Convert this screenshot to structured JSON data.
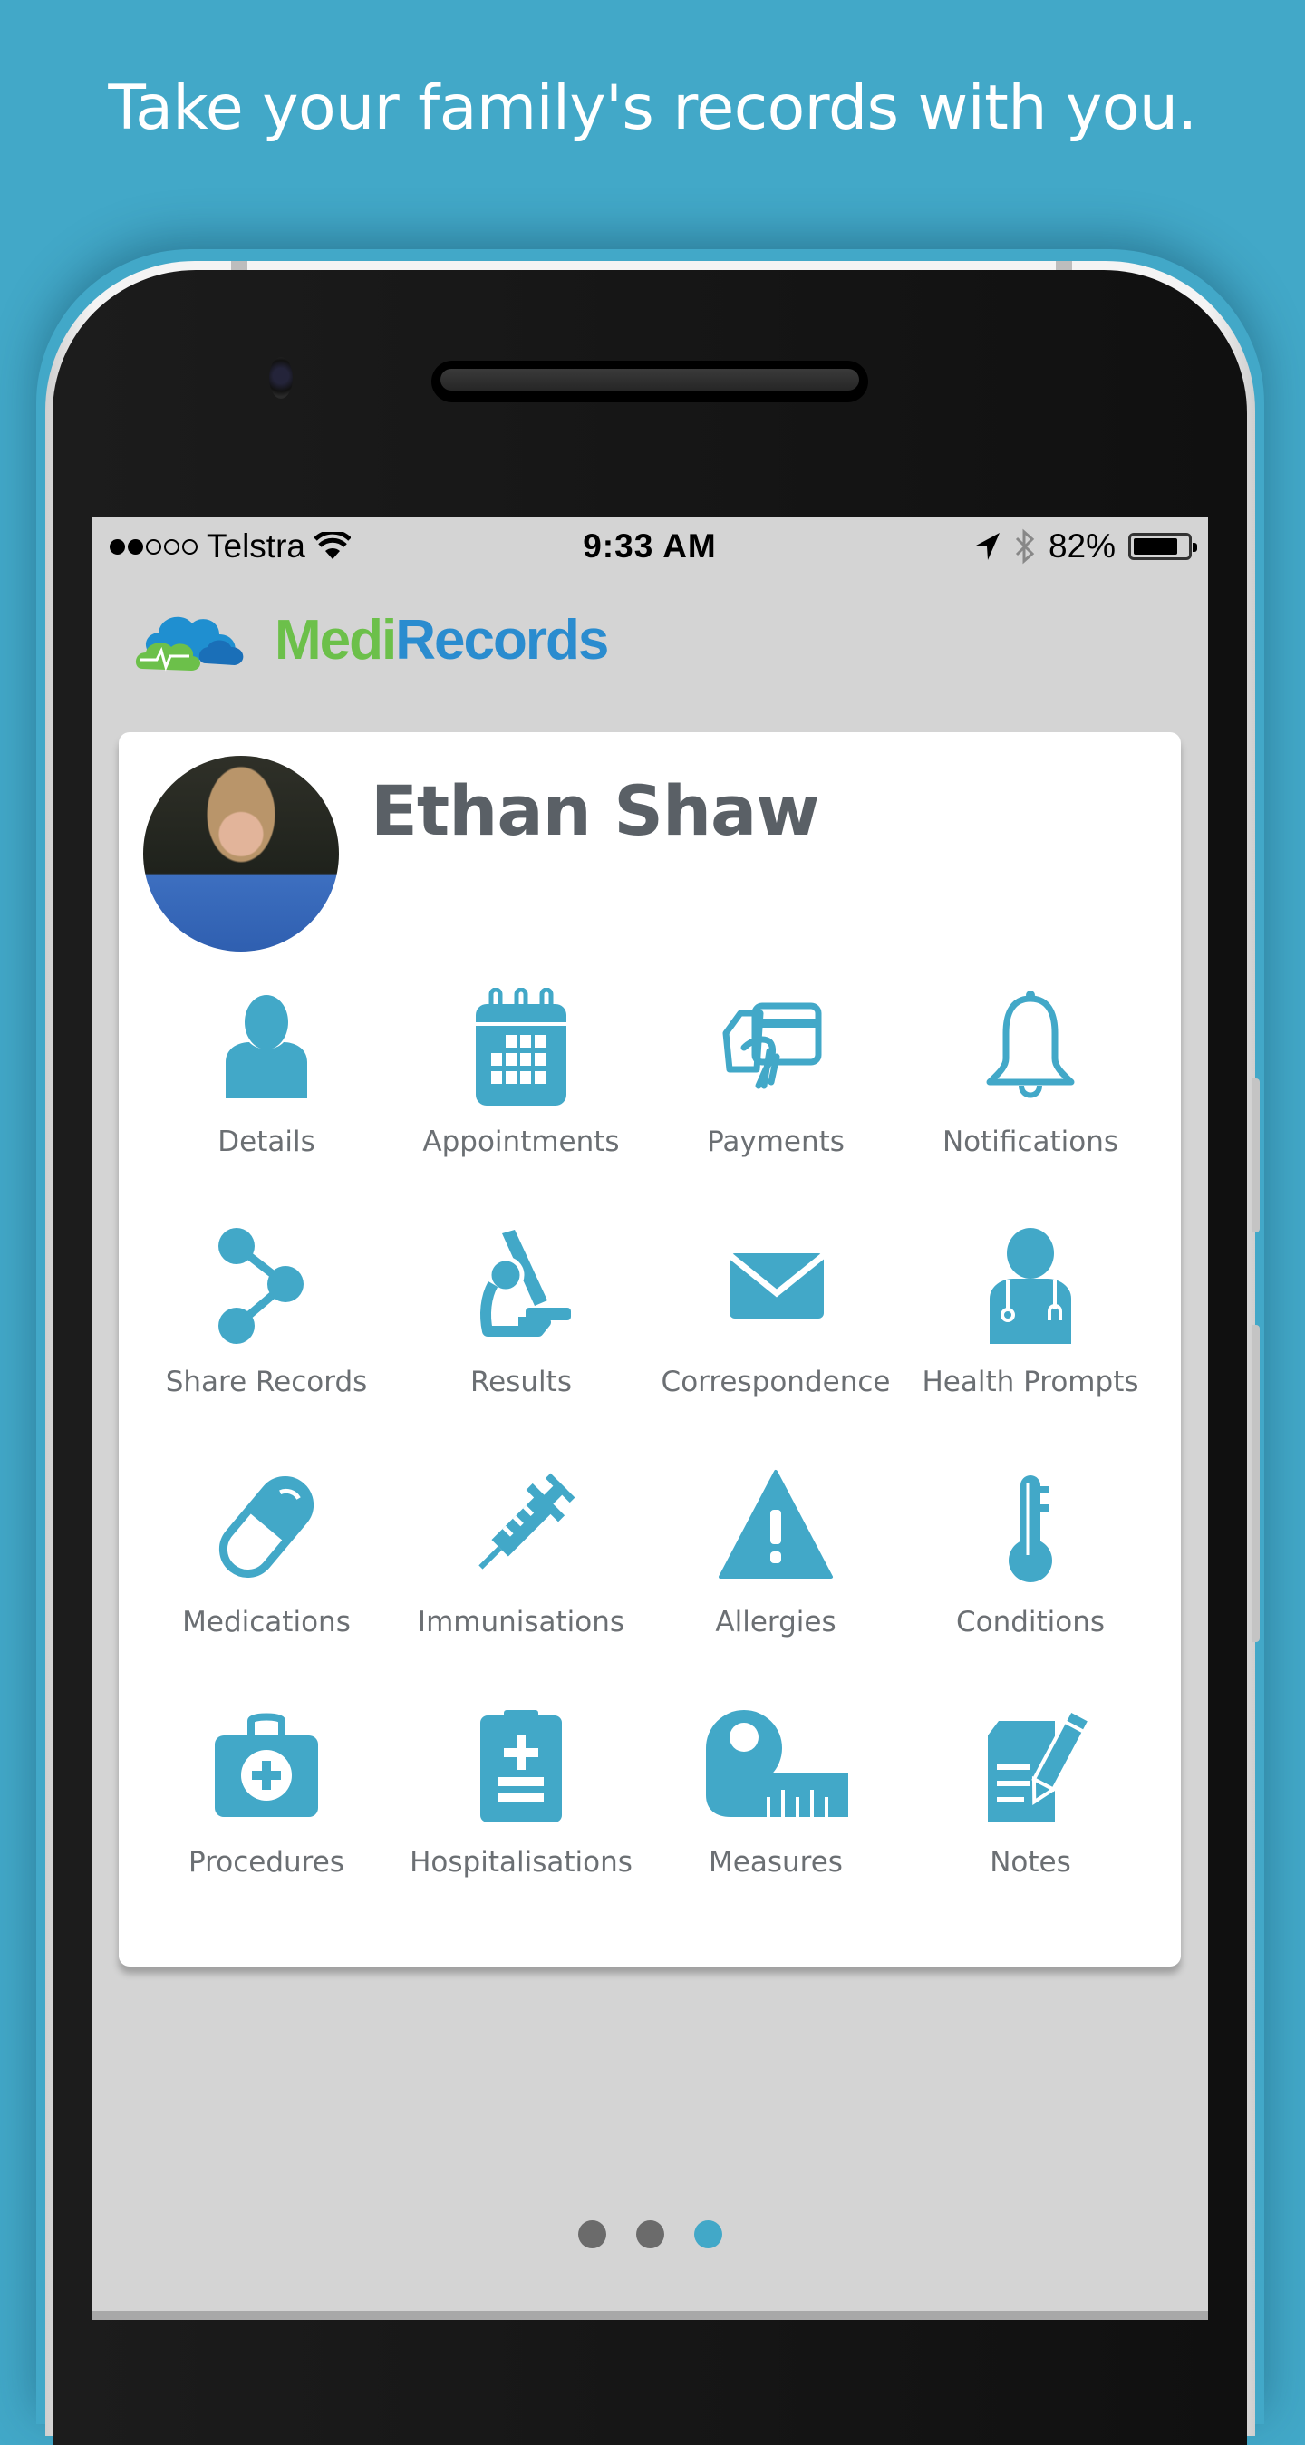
{
  "headline": "Take your family's records with you.",
  "status_bar": {
    "signal_bars_filled": 2,
    "signal_bars_total": 5,
    "carrier": "Telstra",
    "wifi_icon": "wifi-icon",
    "time": "9:33 AM",
    "location_icon": "location-arrow-icon",
    "bluetooth_icon": "bluetooth-icon",
    "battery_percent_label": "82%",
    "battery_level": 0.82
  },
  "app": {
    "logo": {
      "part1": "Medi",
      "part2": "Records",
      "icon": "cloud-heartbeat-icon"
    },
    "colors": {
      "accent": "#42a8c8",
      "logo_green": "#6cc04a",
      "logo_blue": "#2a8ccf",
      "background": "#d4d4d4"
    }
  },
  "profile": {
    "name": "Ethan Shaw",
    "avatar": "child-photo-avatar"
  },
  "menu": [
    {
      "label": "Details",
      "icon": "user-icon"
    },
    {
      "label": "Appointments",
      "icon": "calendar-icon"
    },
    {
      "label": "Payments",
      "icon": "credit-card-hand-icon"
    },
    {
      "label": "Notifications",
      "icon": "bell-icon"
    },
    {
      "label": "Share Records",
      "icon": "share-icon"
    },
    {
      "label": "Results",
      "icon": "microscope-icon"
    },
    {
      "label": "Correspondence",
      "icon": "envelope-icon"
    },
    {
      "label": "Health Prompts",
      "icon": "doctor-icon"
    },
    {
      "label": "Medications",
      "icon": "pill-icon"
    },
    {
      "label": "Immunisations",
      "icon": "syringe-icon"
    },
    {
      "label": "Allergies",
      "icon": "warning-icon"
    },
    {
      "label": "Conditions",
      "icon": "thermometer-icon"
    },
    {
      "label": "Procedures",
      "icon": "medical-kit-icon"
    },
    {
      "label": "Hospitalisations",
      "icon": "clipboard-plus-icon"
    },
    {
      "label": "Measures",
      "icon": "tape-measure-icon"
    },
    {
      "label": "Notes",
      "icon": "notes-pencil-icon"
    }
  ],
  "pager": {
    "total": 3,
    "active_index": 2
  }
}
